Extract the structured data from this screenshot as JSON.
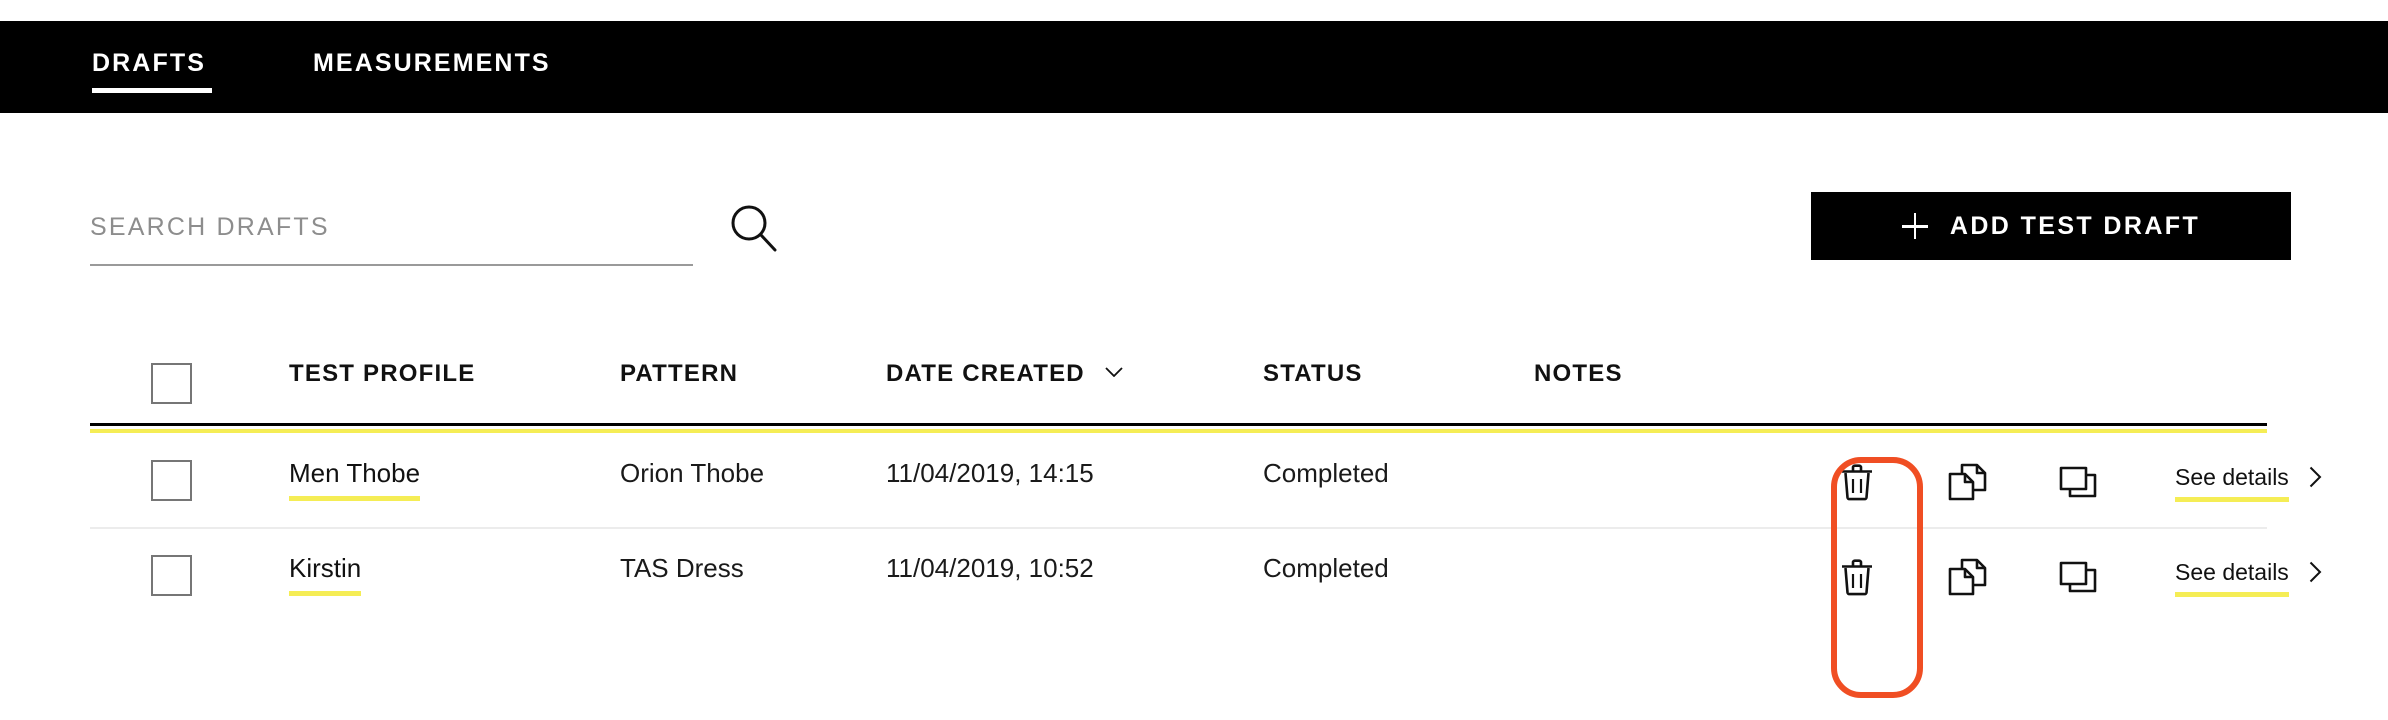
{
  "nav": {
    "tabs": [
      {
        "label": "DRAFTS",
        "active": true
      },
      {
        "label": "MEASUREMENTS",
        "active": false
      }
    ]
  },
  "search": {
    "placeholder": "SEARCH DRAFTS",
    "value": "",
    "icon": "search-icon"
  },
  "toolbar": {
    "add_label": "ADD TEST DRAFT",
    "add_icon": "plus-icon"
  },
  "table": {
    "columns": [
      {
        "key": "select",
        "label": ""
      },
      {
        "key": "profile",
        "label": "TEST PROFILE"
      },
      {
        "key": "pattern",
        "label": "PATTERN"
      },
      {
        "key": "date",
        "label": "DATE CREATED",
        "sort_icon": "chevron-down-icon",
        "sorted": true
      },
      {
        "key": "status",
        "label": "STATUS"
      },
      {
        "key": "notes",
        "label": "NOTES"
      }
    ],
    "select_all_checked": false,
    "rows": [
      {
        "selected": false,
        "profile": "Men Thobe",
        "pattern": "Orion Thobe",
        "date": "11/04/2019, 14:15",
        "status": "Completed",
        "notes": "",
        "actions": {
          "delete_icon": "trash-icon",
          "duplicate_icon": "copy-icon",
          "clone_icon": "clone-windows-icon",
          "details_label": "See details",
          "details_chevron": "chevron-right-icon"
        }
      },
      {
        "selected": false,
        "profile": "Kirstin",
        "pattern": "TAS Dress",
        "date": "11/04/2019, 10:52",
        "status": "Completed",
        "notes": "",
        "actions": {
          "delete_icon": "trash-icon",
          "duplicate_icon": "copy-icon",
          "clone_icon": "clone-windows-icon",
          "details_label": "See details",
          "details_chevron": "chevron-right-icon"
        }
      }
    ]
  },
  "annotation": {
    "shape": "rounded-rectangle",
    "color": "#F04E23",
    "targets": "delete-icon-column"
  },
  "colors": {
    "accent_yellow": "#F5ED55",
    "nav_background": "#000000",
    "annotation_red": "#F04E23",
    "text_primary": "#111111",
    "placeholder_gray": "#8D8D8D",
    "checkbox_border": "#767676",
    "row_divider": "#ECECEC"
  }
}
